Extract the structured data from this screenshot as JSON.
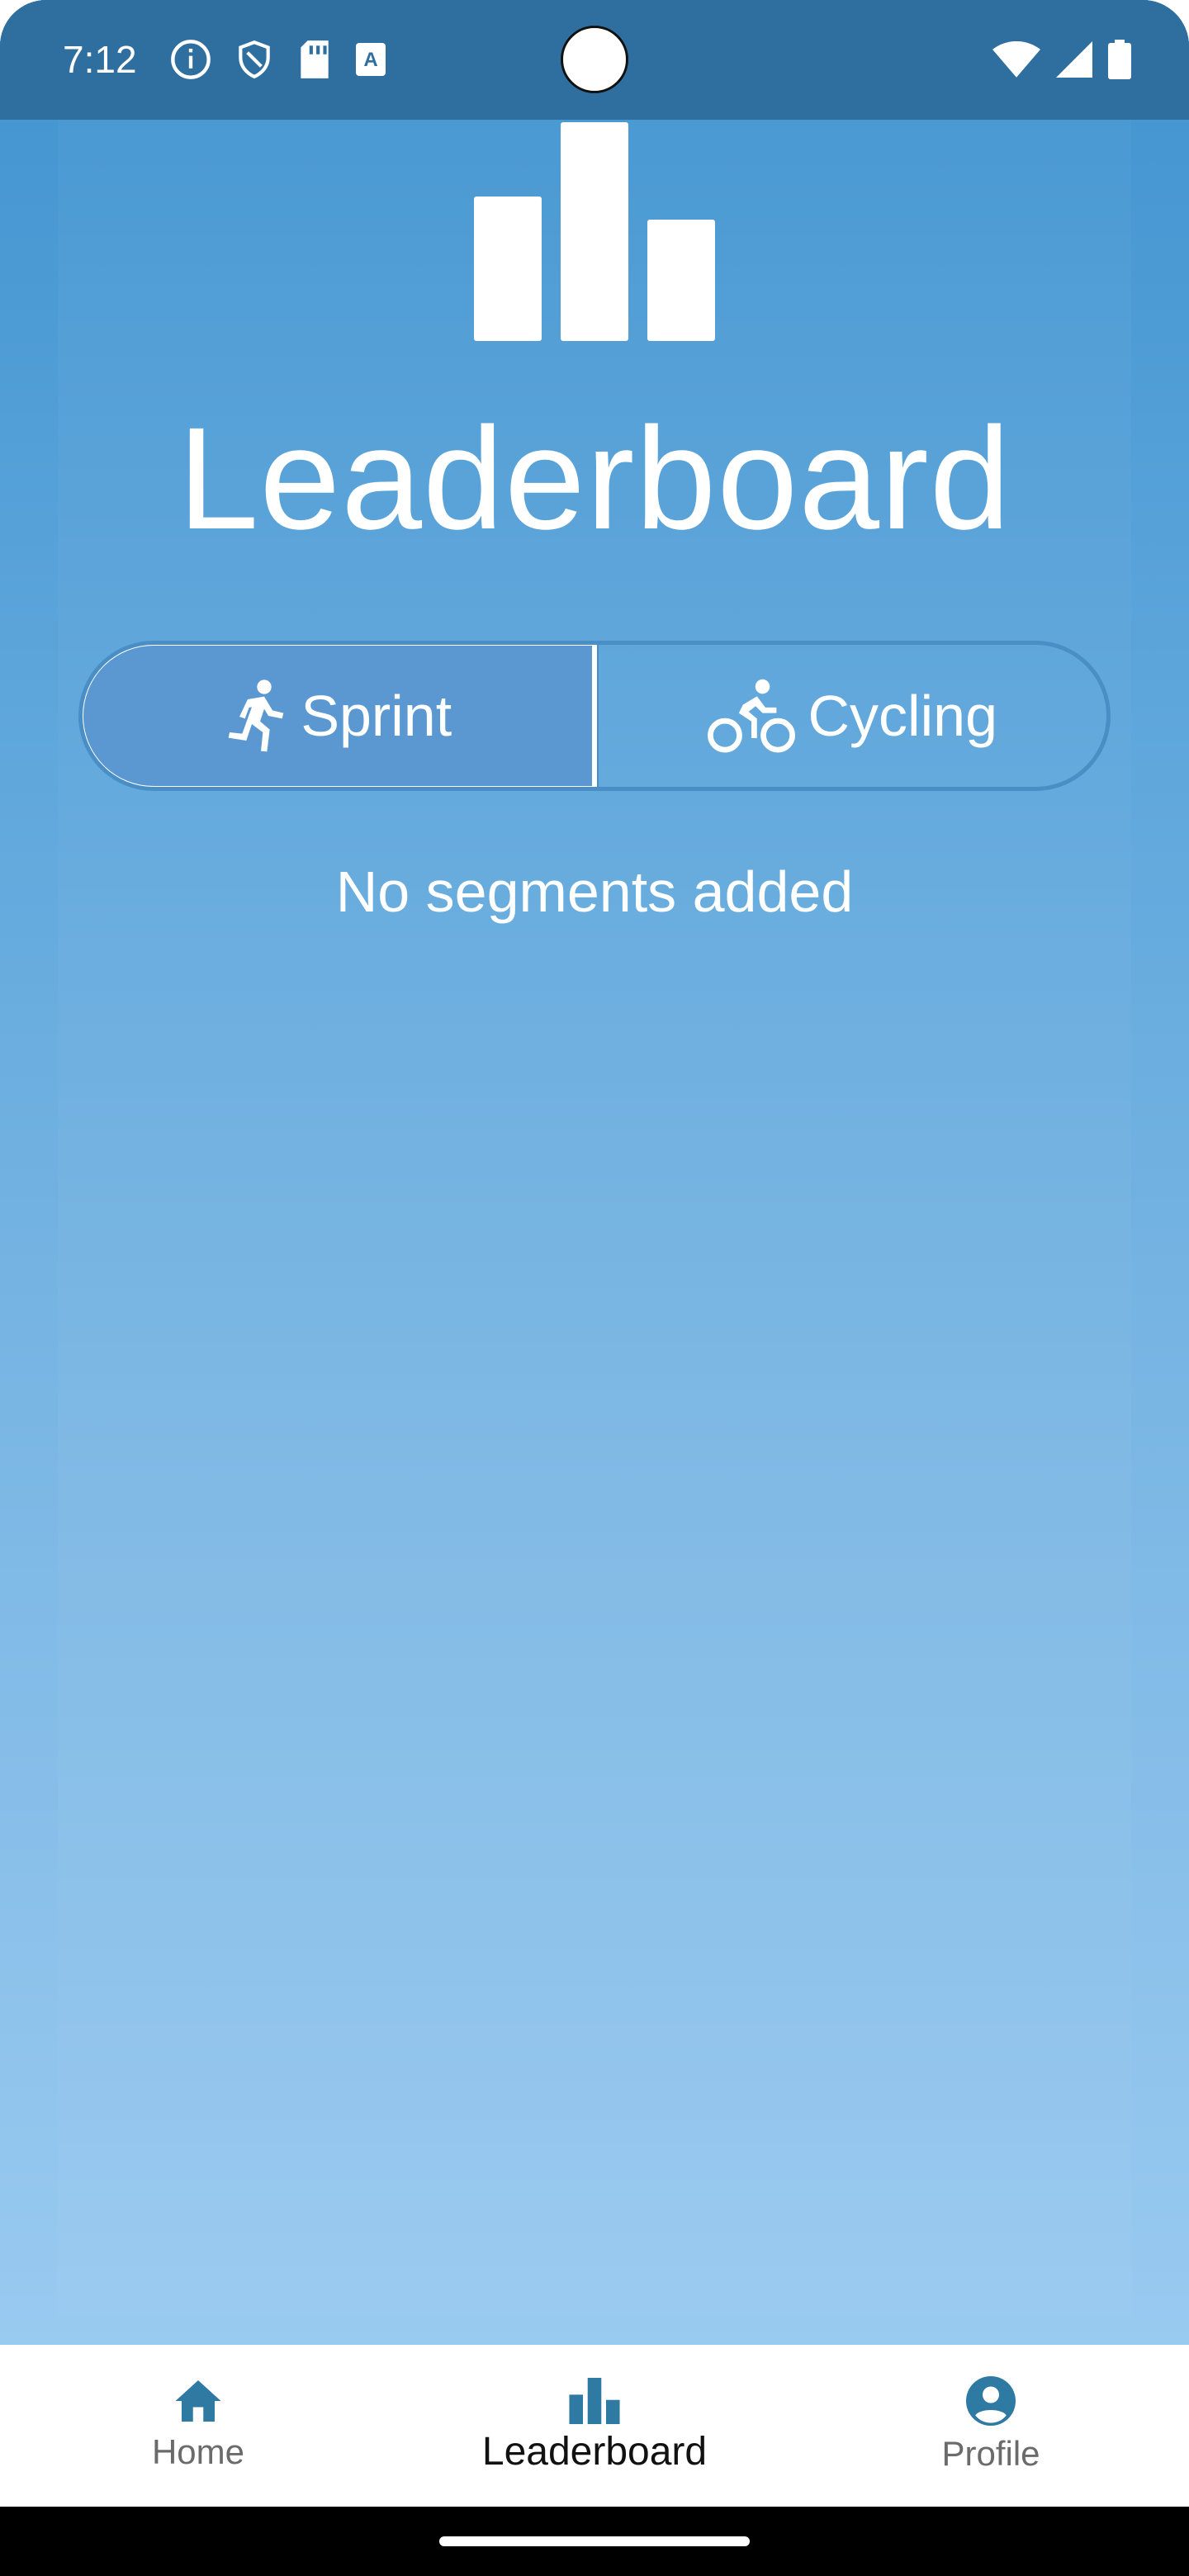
{
  "status_bar": {
    "time": "7:12",
    "icons_left": [
      "info-icon",
      "shield-icon",
      "sd-card-icon",
      "keyboard-a-icon"
    ],
    "icons_right": [
      "wifi-icon",
      "signal-icon",
      "battery-icon"
    ]
  },
  "header": {
    "icon": "leaderboard-bar-chart-icon",
    "title": "Leaderboard"
  },
  "segments": [
    {
      "label": "Sprint",
      "icon": "run-icon",
      "selected": true
    },
    {
      "label": "Cycling",
      "icon": "bike-icon",
      "selected": false
    }
  ],
  "empty_state": "No segments added",
  "bottom_nav": [
    {
      "label": "Home",
      "icon": "home-icon",
      "active": false
    },
    {
      "label": "Leaderboard",
      "icon": "leaderboard-icon",
      "active": true
    },
    {
      "label": "Profile",
      "icon": "account-circle-icon",
      "active": false
    }
  ],
  "colors": {
    "status_bar": "#2f6f9f",
    "gradient_top": "#4193d0",
    "gradient_bottom": "#99caf0",
    "nav_icon": "#2f7aa3",
    "selected_segment": "#5b98d1"
  }
}
